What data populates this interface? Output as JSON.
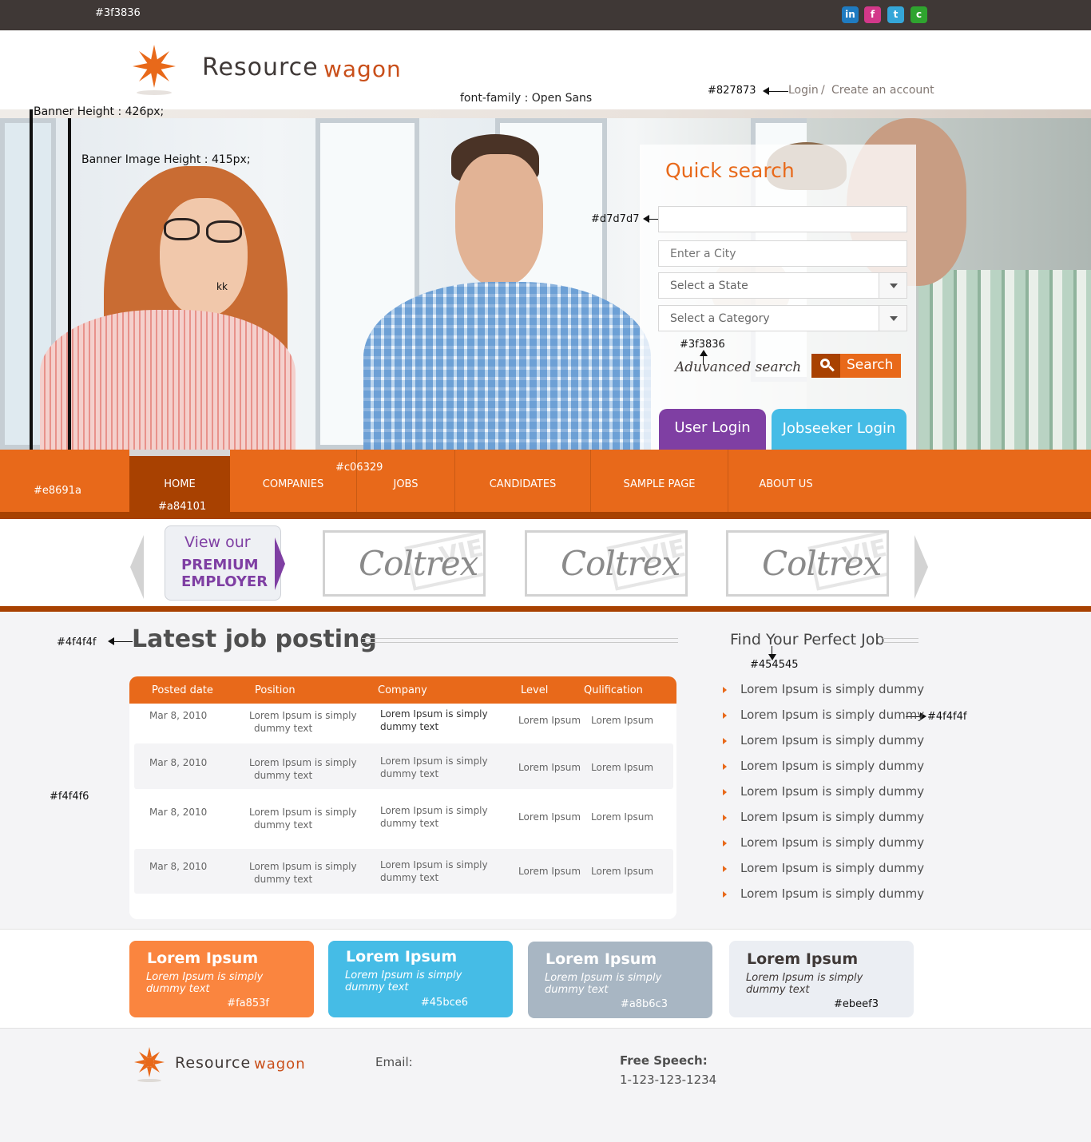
{
  "colors": {
    "topbar": "#3f3836",
    "primary": "#e8691a",
    "primary_dark": "#a84101",
    "purple": "#7f3fa3",
    "blue": "#45bce6",
    "field_border": "#d7d7d7",
    "link_gray": "#827873",
    "text": "#4f4f4f",
    "card_orange": "#fa853f",
    "card_blue": "#45bce6",
    "card_gray": "#a8b6c3",
    "card_light": "#ebeef3"
  },
  "topbar": {
    "hex_note": "#3f3836",
    "social": [
      {
        "icon": "linkedin-icon",
        "glyph": "in",
        "color": "#1f7bc1"
      },
      {
        "icon": "facebook-icon",
        "glyph": "f",
        "color": "#d3388a"
      },
      {
        "icon": "twitter-icon",
        "glyph": "t",
        "color": "#35a6d8"
      },
      {
        "icon": "chat-icon",
        "glyph": "c",
        "color": "#2fa42f"
      }
    ]
  },
  "header": {
    "logo_word1": "Resource",
    "logo_word2": "wagon",
    "font_note": "font-family : Open Sans",
    "link_hex_note": "#827873",
    "login": "Login",
    "separator": "/",
    "create_account": "Create an account"
  },
  "banner": {
    "height_note": "Banner Height : 426px;",
    "image_height_note": "Banner Image Height : 415px;",
    "stray_text": "kk"
  },
  "quick_search": {
    "title": "Quick search",
    "field_hex_note": "#d7d7d7",
    "keyword_value": "",
    "city_placeholder": "Enter a City",
    "state_selected": "Select a State",
    "category_selected": "Select a Category",
    "adv_hex_note": "#3f3836",
    "advanced_link": "Aduvanced search",
    "search_button": "Search",
    "user_login": "User Login",
    "jobseeker_login": "Jobseeker Login"
  },
  "nav": {
    "bar_hex_note": "#e8691a",
    "active_hex_note": "#a84101",
    "border_hex_note": "#c06329",
    "items": [
      "HOME",
      "COMPANIES",
      "JOBS",
      "CANDIDATES",
      "SAMPLE PAGE",
      "ABOUT US"
    ]
  },
  "employers": {
    "view_our": "View our",
    "premium": "PREMIUM",
    "employer": "EMPLOYER",
    "brands": [
      "Coltrex",
      "Coltrex",
      "Coltrex"
    ],
    "stamp_text": "VIE"
  },
  "latest_jobs": {
    "title_hex_note": "#4f4f4f",
    "title": "Latest job posting",
    "bg_hex_note": "#f4f4f6",
    "columns": [
      "Posted date",
      "Position",
      "Company",
      "Level",
      "Qulification"
    ],
    "rows": [
      {
        "date": "Mar 8, 2010",
        "pos1": "Lorem Ipsum is simply",
        "pos2": "dummy text",
        "co1": "Lorem Ipsum is simply",
        "co2": "dummy text",
        "level": "Lorem Ipsum",
        "qual": "Lorem Ipsum"
      },
      {
        "date": "Mar 8, 2010",
        "pos1": "Lorem Ipsum is simply",
        "pos2": "dummy text",
        "co1": "Lorem Ipsum is simply",
        "co2": "dummy text",
        "level": "Lorem Ipsum",
        "qual": "Lorem Ipsum"
      },
      {
        "date": "Mar 8, 2010",
        "pos1": "Lorem Ipsum is simply",
        "pos2": "dummy text",
        "co1": "Lorem Ipsum is simply",
        "co2": "dummy text",
        "level": "Lorem Ipsum",
        "qual": "Lorem Ipsum"
      },
      {
        "date": "Mar 8, 2010",
        "pos1": "Lorem Ipsum is simply",
        "pos2": "dummy text",
        "co1": "Lorem Ipsum is simply",
        "co2": "dummy text",
        "level": "Lorem Ipsum",
        "qual": "Lorem Ipsum"
      }
    ]
  },
  "find_job": {
    "title": "Find Your Perfect Job",
    "title_hex_note": "#454545",
    "item_hex_note": "#4f4f4f",
    "items": [
      "Lorem Ipsum is simply dummy",
      "Lorem Ipsum is simply dummy",
      "Lorem Ipsum is simply dummy",
      "Lorem Ipsum is simply dummy",
      "Lorem Ipsum is simply dummy",
      "Lorem Ipsum is simply dummy",
      "Lorem Ipsum is simply dummy",
      "Lorem Ipsum is simply dummy",
      "Lorem Ipsum is simply dummy"
    ]
  },
  "color_cards": [
    {
      "title": "Lorem Ipsum",
      "desc1": "Lorem Ipsum is simply",
      "desc2": "dummy text",
      "hex": "#fa853f"
    },
    {
      "title": "Lorem Ipsum",
      "desc1": "Lorem Ipsum is simply",
      "desc2": "dummy text",
      "hex": "#45bce6"
    },
    {
      "title": "Lorem Ipsum",
      "desc1": "Lorem Ipsum is simply",
      "desc2": "dummy text",
      "hex": "#a8b6c3"
    },
    {
      "title": "Lorem Ipsum",
      "desc1": "Lorem Ipsum is simply",
      "desc2": "dummy text",
      "hex": "#ebeef3"
    }
  ],
  "footer": {
    "logo_word1": "Resource",
    "logo_word2": "wagon",
    "email_label": "Email:",
    "speech_label": "Free Speech:",
    "phone": "1-123-123-1234"
  }
}
